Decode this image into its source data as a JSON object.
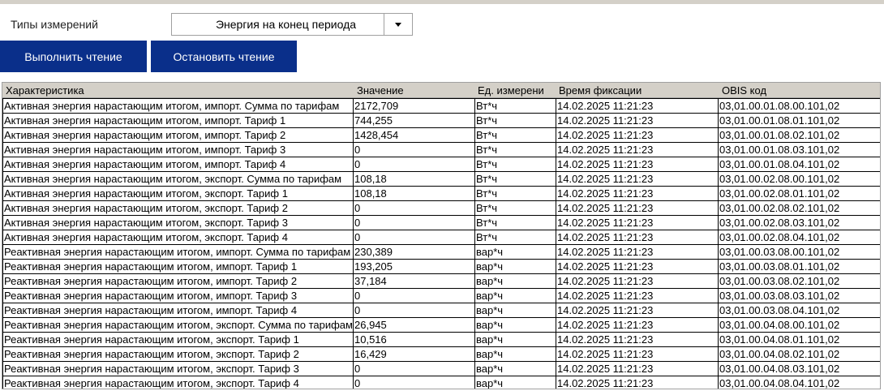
{
  "measurement_type_label": "Типы измерений",
  "measurement_type_value": "Энергия на конец периода",
  "buttons": {
    "read": "Выполнить чтение",
    "stop": "Остановить чтение"
  },
  "table": {
    "headers": [
      "Характеристика",
      "Значение",
      "Ед. измерени",
      "Время фиксации",
      "OBIS код"
    ],
    "rows": [
      [
        "Активная энергия нарастающим итогом, импорт. Сумма по тарифам",
        "2172,709",
        "Вт*ч",
        "14.02.2025 11:21:23",
        "03,01.00.01.08.00.101,02"
      ],
      [
        "Активная энергия нарастающим итогом, импорт. Тариф 1",
        "744,255",
        "Вт*ч",
        "14.02.2025 11:21:23",
        "03,01.00.01.08.01.101,02"
      ],
      [
        "Активная энергия нарастающим итогом, импорт. Тариф 2",
        "1428,454",
        "Вт*ч",
        "14.02.2025 11:21:23",
        "03,01.00.01.08.02.101,02"
      ],
      [
        "Активная энергия нарастающим итогом, импорт. Тариф 3",
        "0",
        "Вт*ч",
        "14.02.2025 11:21:23",
        "03,01.00.01.08.03.101,02"
      ],
      [
        "Активная энергия нарастающим итогом, импорт. Тариф 4",
        "0",
        "Вт*ч",
        "14.02.2025 11:21:23",
        "03,01.00.01.08.04.101,02"
      ],
      [
        "Активная энергия нарастающим итогом, экспорт. Сумма по тарифам",
        "108,18",
        "Вт*ч",
        "14.02.2025 11:21:23",
        "03,01.00.02.08.00.101,02"
      ],
      [
        "Активная энергия нарастающим итогом, экспорт. Тариф 1",
        "108,18",
        "Вт*ч",
        "14.02.2025 11:21:23",
        "03,01.00.02.08.01.101,02"
      ],
      [
        "Активная энергия нарастающим итогом, экспорт. Тариф 2",
        "0",
        "Вт*ч",
        "14.02.2025 11:21:23",
        "03,01.00.02.08.02.101,02"
      ],
      [
        "Активная энергия нарастающим итогом, экспорт. Тариф 3",
        "0",
        "Вт*ч",
        "14.02.2025 11:21:23",
        "03,01.00.02.08.03.101,02"
      ],
      [
        "Активная энергия нарастающим итогом, экспорт. Тариф 4",
        "0",
        "Вт*ч",
        "14.02.2025 11:21:23",
        "03,01.00.02.08.04.101,02"
      ],
      [
        "Реактивная энергия нарастающим итогом, импорт. Сумма по тарифам",
        "230,389",
        "вар*ч",
        "14.02.2025 11:21:23",
        "03,01.00.03.08.00.101,02"
      ],
      [
        "Реактивная энергия нарастающим итогом, импорт. Тариф 1",
        "193,205",
        "вар*ч",
        "14.02.2025 11:21:23",
        "03,01.00.03.08.01.101,02"
      ],
      [
        "Реактивная энергия нарастающим итогом, импорт. Тариф 2",
        "37,184",
        "вар*ч",
        "14.02.2025 11:21:23",
        "03,01.00.03.08.02.101,02"
      ],
      [
        "Реактивная энергия нарастающим итогом, импорт. Тариф 3",
        "0",
        "вар*ч",
        "14.02.2025 11:21:23",
        "03,01.00.03.08.03.101,02"
      ],
      [
        "Реактивная энергия нарастающим итогом, импорт. Тариф 4",
        "0",
        "вар*ч",
        "14.02.2025 11:21:23",
        "03,01.00.03.08.04.101,02"
      ],
      [
        "Реактивная энергия нарастающим итогом, экспорт. Сумма по тарифам",
        "26,945",
        "вар*ч",
        "14.02.2025 11:21:23",
        "03,01.00.04.08.00.101,02"
      ],
      [
        "Реактивная энергия нарастающим итогом, экспорт. Тариф 1",
        "10,516",
        "вар*ч",
        "14.02.2025 11:21:23",
        "03,01.00.04.08.01.101,02"
      ],
      [
        "Реактивная энергия нарастающим итогом, экспорт. Тариф 2",
        "16,429",
        "вар*ч",
        "14.02.2025 11:21:23",
        "03,01.00.04.08.02.101,02"
      ],
      [
        "Реактивная энергия нарастающим итогом, экспорт. Тариф 3",
        "0",
        "вар*ч",
        "14.02.2025 11:21:23",
        "03,01.00.04.08.03.101,02"
      ],
      [
        "Реактивная энергия нарастающим итогом, экспорт. Тариф 4",
        "0",
        "вар*ч",
        "14.02.2025 11:21:23",
        "03,01.00.04.08.04.101,02"
      ]
    ]
  },
  "colors": {
    "button_bg": "#0a2f8a",
    "header_bg": "#d4d0c8"
  },
  "icons": {
    "dropdown": "chevron-down-icon"
  }
}
